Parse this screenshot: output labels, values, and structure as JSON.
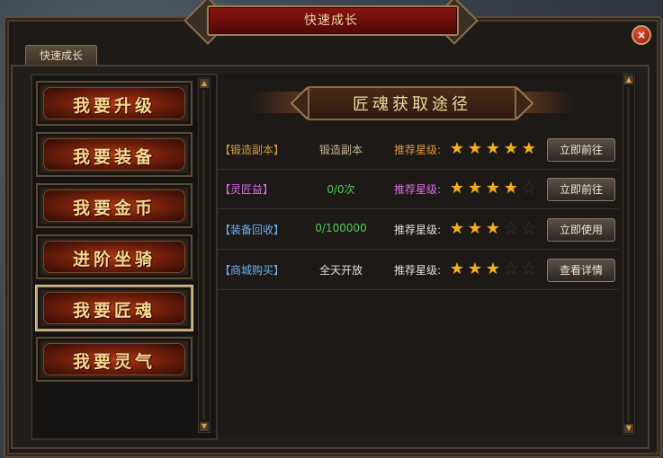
{
  "window": {
    "title": "快速成长",
    "tab_label": "快速成长",
    "close_glyph": "×"
  },
  "menu": [
    {
      "label": "我要升级",
      "selected": false
    },
    {
      "label": "我要装备",
      "selected": false
    },
    {
      "label": "我要金币",
      "selected": false
    },
    {
      "label": "进阶坐骑",
      "selected": false
    },
    {
      "label": "我要匠魂",
      "selected": true
    },
    {
      "label": "我要灵气",
      "selected": false
    }
  ],
  "content": {
    "banner": "匠魂获取途径",
    "rows": [
      {
        "source": "【锻造副本】",
        "source_color": "#d89a40",
        "value": "锻造副本",
        "value_color": "#c8b890",
        "rec_label": "推荐星级:",
        "rec_color": "#d89a40",
        "stars": 5,
        "action": "立即前往"
      },
      {
        "source": "【灵匠益】",
        "source_color": "#d870e0",
        "value": "0/0次",
        "value_color": "#50d050",
        "rec_label": "推荐星级:",
        "rec_color": "#d870e0",
        "stars": 4,
        "action": "立即前往"
      },
      {
        "source": "【装备回收】",
        "source_color": "#70b0f0",
        "value": "0/100000",
        "value_color": "#50d050",
        "rec_label": "推荐星级:",
        "rec_color": "#e0e0e0",
        "stars": 3,
        "action": "立即使用"
      },
      {
        "source": "【商城购买】",
        "source_color": "#70b0f0",
        "value": "全天开放",
        "value_color": "#e0e0e0",
        "rec_label": "推荐星级:",
        "rec_color": "#e0e0e0",
        "stars": 3,
        "action": "查看详情"
      }
    ]
  },
  "icons": {
    "scroll_up": "▲",
    "scroll_down": "▼",
    "star": "★"
  }
}
